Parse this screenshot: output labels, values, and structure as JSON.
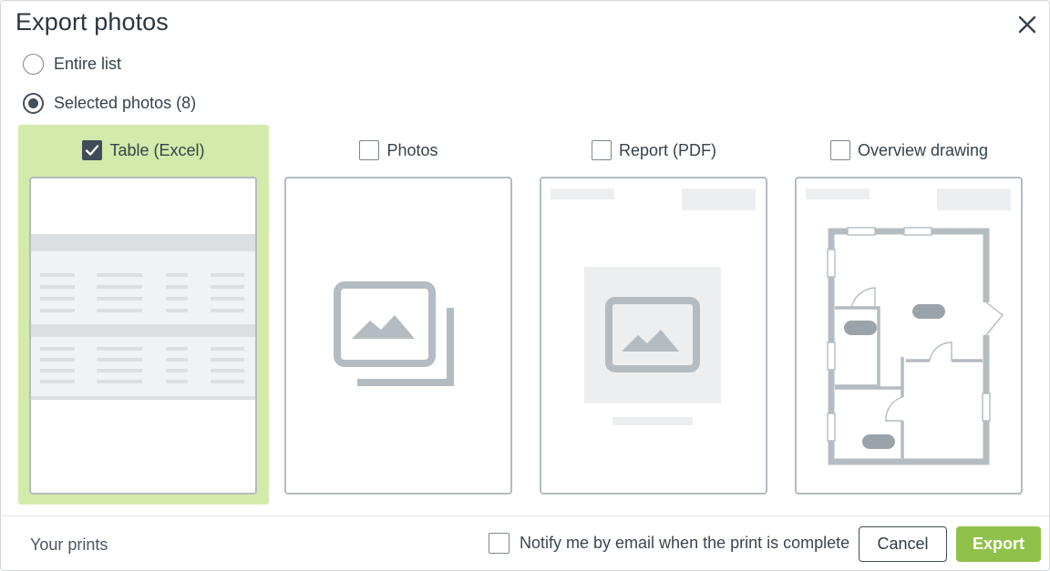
{
  "dialog": {
    "title": "Export photos",
    "close_icon": "close-icon"
  },
  "scope": {
    "options": [
      {
        "label": "Entire list",
        "checked": false
      },
      {
        "label": "Selected photos (8)",
        "checked": true
      }
    ]
  },
  "formats": [
    {
      "label": "Table (Excel)",
      "checked": true,
      "preview": "table-preview-icon"
    },
    {
      "label": "Photos",
      "checked": false,
      "preview": "photos-stack-icon"
    },
    {
      "label": "Report (PDF)",
      "checked": false,
      "preview": "report-page-icon"
    },
    {
      "label": "Overview drawing",
      "checked": false,
      "preview": "floor-plan-icon"
    }
  ],
  "footer": {
    "your_prints": "Your prints",
    "notify_label": "Notify me by email when the print is complete",
    "notify_checked": false,
    "cancel_label": "Cancel",
    "export_label": "Export"
  },
  "colors": {
    "selected_bg": "#d3eaaa",
    "export_button": "#8fc14a",
    "dark_text": "#2f3b45",
    "preview_gray": "#b4bcc2"
  }
}
